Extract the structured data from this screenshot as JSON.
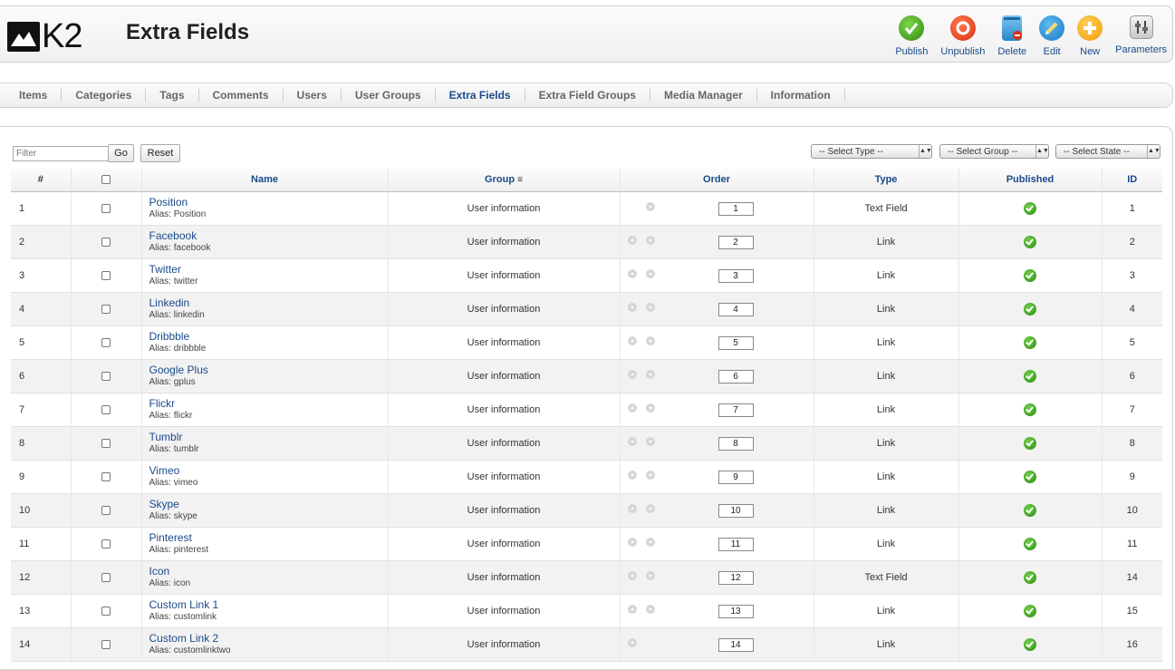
{
  "header": {
    "logo_text": "K2",
    "title": "Extra Fields",
    "toolbar": [
      {
        "id": "publish",
        "label": "Publish",
        "icon": "publish-icon"
      },
      {
        "id": "unpublish",
        "label": "Unpublish",
        "icon": "unpublish-icon"
      },
      {
        "id": "delete",
        "label": "Delete",
        "icon": "delete-icon"
      },
      {
        "id": "edit",
        "label": "Edit",
        "icon": "edit-icon"
      },
      {
        "id": "new",
        "label": "New",
        "icon": "new-icon"
      },
      {
        "id": "parameters",
        "label": "Parameters",
        "icon": "parameters-icon"
      }
    ]
  },
  "tabs": [
    {
      "label": "Items",
      "active": false
    },
    {
      "label": "Categories",
      "active": false
    },
    {
      "label": "Tags",
      "active": false
    },
    {
      "label": "Comments",
      "active": false
    },
    {
      "label": "Users",
      "active": false
    },
    {
      "label": "User Groups",
      "active": false
    },
    {
      "label": "Extra Fields",
      "active": true
    },
    {
      "label": "Extra Field Groups",
      "active": false
    },
    {
      "label": "Media Manager",
      "active": false
    },
    {
      "label": "Information",
      "active": false
    }
  ],
  "filters": {
    "filter_placeholder": "Filter",
    "go_label": "Go",
    "reset_label": "Reset",
    "select_type": "-- Select Type --",
    "select_group": "-- Select Group --",
    "select_state": "-- Select State --"
  },
  "table": {
    "columns": {
      "num": "#",
      "name": "Name",
      "group": "Group",
      "order": "Order",
      "type": "Type",
      "published": "Published",
      "id": "ID"
    },
    "rows": [
      {
        "num": "1",
        "name": "Position",
        "alias": "Alias: Position",
        "group": "User information",
        "order": "1",
        "type": "Text Field",
        "id": "1",
        "up": false,
        "down": true
      },
      {
        "num": "2",
        "name": "Facebook",
        "alias": "Alias: facebook",
        "group": "User information",
        "order": "2",
        "type": "Link",
        "id": "2",
        "up": true,
        "down": true
      },
      {
        "num": "3",
        "name": "Twitter",
        "alias": "Alias: twitter",
        "group": "User information",
        "order": "3",
        "type": "Link",
        "id": "3",
        "up": true,
        "down": true
      },
      {
        "num": "4",
        "name": "Linkedin",
        "alias": "Alias: linkedin",
        "group": "User information",
        "order": "4",
        "type": "Link",
        "id": "4",
        "up": true,
        "down": true
      },
      {
        "num": "5",
        "name": "Dribbble",
        "alias": "Alias: dribbble",
        "group": "User information",
        "order": "5",
        "type": "Link",
        "id": "5",
        "up": true,
        "down": true
      },
      {
        "num": "6",
        "name": "Google Plus",
        "alias": "Alias: gplus",
        "group": "User information",
        "order": "6",
        "type": "Link",
        "id": "6",
        "up": true,
        "down": true
      },
      {
        "num": "7",
        "name": "Flickr",
        "alias": "Alias: flickr",
        "group": "User information",
        "order": "7",
        "type": "Link",
        "id": "7",
        "up": true,
        "down": true
      },
      {
        "num": "8",
        "name": "Tumblr",
        "alias": "Alias: tumblr",
        "group": "User information",
        "order": "8",
        "type": "Link",
        "id": "8",
        "up": true,
        "down": true
      },
      {
        "num": "9",
        "name": "Vimeo",
        "alias": "Alias: vimeo",
        "group": "User information",
        "order": "9",
        "type": "Link",
        "id": "9",
        "up": true,
        "down": true
      },
      {
        "num": "10",
        "name": "Skype",
        "alias": "Alias: skype",
        "group": "User information",
        "order": "10",
        "type": "Link",
        "id": "10",
        "up": true,
        "down": true
      },
      {
        "num": "11",
        "name": "Pinterest",
        "alias": "Alias: pinterest",
        "group": "User information",
        "order": "11",
        "type": "Link",
        "id": "11",
        "up": true,
        "down": true
      },
      {
        "num": "12",
        "name": "Icon",
        "alias": "Alias: icon",
        "group": "User information",
        "order": "12",
        "type": "Text Field",
        "id": "14",
        "up": true,
        "down": true
      },
      {
        "num": "13",
        "name": "Custom Link 1",
        "alias": "Alias: customlink",
        "group": "User information",
        "order": "13",
        "type": "Link",
        "id": "15",
        "up": true,
        "down": true
      },
      {
        "num": "14",
        "name": "Custom Link 2",
        "alias": "Alias: customlinktwo",
        "group": "User information",
        "order": "14",
        "type": "Link",
        "id": "16",
        "up": true,
        "down": false
      }
    ]
  }
}
